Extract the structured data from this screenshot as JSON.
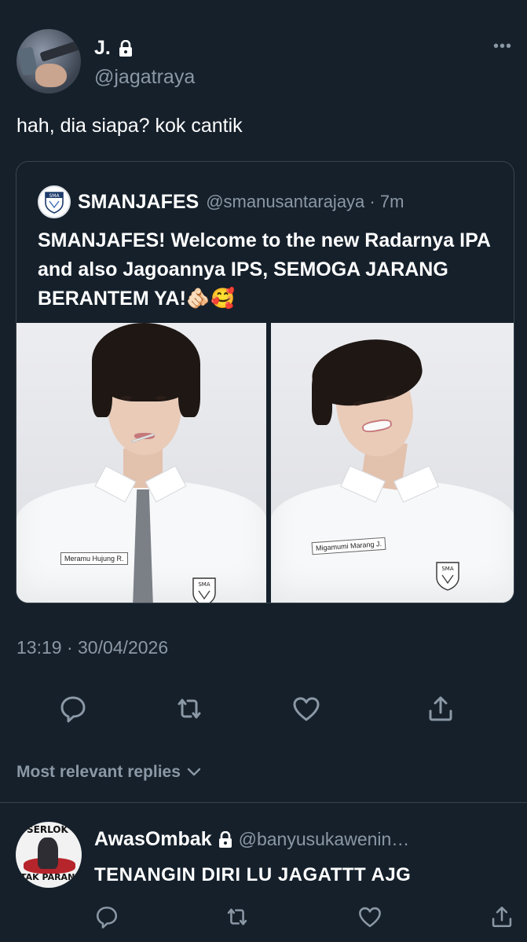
{
  "tweet": {
    "display_name": "J.",
    "handle": "@jagatraya",
    "text": "hah, dia siapa? kok cantik",
    "more": "•••",
    "timestamp": "13:19 · 30/04/2026",
    "protected": true
  },
  "quote": {
    "display_name": "SMANJAFES",
    "handle": "@smanusantarajaya · 7m",
    "text": "SMANJAFES! Welcome to the new Radarnya IPA and also Jagoannya IPS, SEMOGA JARANG BERANTEM YA!🫵🏻🥰",
    "avatar_text": "SMA",
    "photos": [
      {
        "name_tag": "Meramu Hujung R.",
        "badge": "SMA"
      },
      {
        "name_tag": "Migamumi Marang J.",
        "badge": "SMA"
      }
    ]
  },
  "actions": [
    "reply-icon",
    "retweet-icon",
    "like-icon",
    "share-icon"
  ],
  "replies": {
    "sort_label": "Most relevant replies",
    "items": [
      {
        "display_name": "AwasOmbak",
        "handle": "@banyusukawenin…",
        "text": "TENANGIN DIRI LU JAGATTT AJG",
        "protected": true,
        "avatar_top_text": "SERLOK",
        "avatar_bottom_text": "TAK PARANI"
      }
    ]
  },
  "colors": {
    "background": "#15202b",
    "secondary_text": "#8b98a5",
    "border": "#38444d"
  }
}
